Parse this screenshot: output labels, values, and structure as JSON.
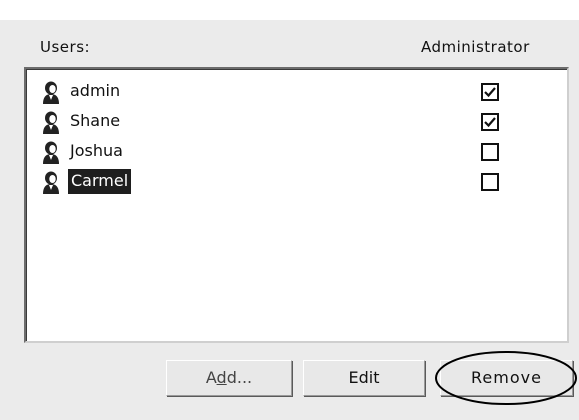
{
  "header": {
    "users_label": "Users:",
    "admin_label": "Administrator"
  },
  "users": [
    {
      "name": "admin",
      "is_admin": true,
      "selected": false,
      "icon": "user-icon"
    },
    {
      "name": "Shane",
      "is_admin": true,
      "selected": false,
      "icon": "user-icon"
    },
    {
      "name": "Joshua",
      "is_admin": false,
      "selected": false,
      "icon": "user-icon"
    },
    {
      "name": "Carmel",
      "is_admin": false,
      "selected": true,
      "icon": "user-icon"
    }
  ],
  "buttons": {
    "add_label_pre": "A",
    "add_label_ul": "d",
    "add_label_post": "d...",
    "edit_label": "Edit",
    "remove_label": "Remove"
  },
  "annotation": {
    "highlight_color": "#000000",
    "highlighted_control": "remove-button"
  },
  "colors": {
    "selection_bg": "#1e1e1e",
    "selection_fg": "#ffffff"
  }
}
